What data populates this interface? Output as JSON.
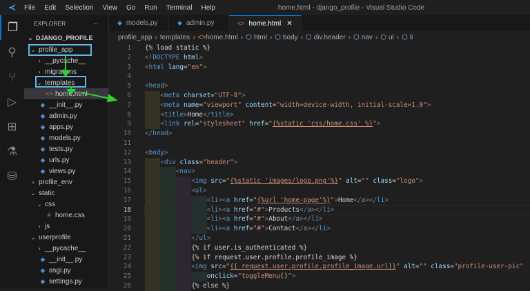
{
  "app": {
    "title": "home.html - django_profile - Visual Studio Code",
    "menu": [
      "File",
      "Edit",
      "Selection",
      "View",
      "Go",
      "Run",
      "Terminal",
      "Help"
    ]
  },
  "activity": [
    "explorer-icon",
    "search-icon",
    "source-control-icon",
    "run-debug-icon",
    "extensions-icon",
    "testing-icon",
    "database-icon"
  ],
  "sidebar": {
    "title": "EXPLORER",
    "more": "···",
    "project": "DJANGO_PROFILE",
    "items": [
      {
        "label": "profile_app",
        "level": 1,
        "kind": "open"
      },
      {
        "label": "__pycache__",
        "level": 2,
        "kind": "closed"
      },
      {
        "label": "migrations",
        "level": 2,
        "kind": "closed"
      },
      {
        "label": "templates",
        "level": 2,
        "kind": "open"
      },
      {
        "label": "home.html",
        "level": 3,
        "kind": "html",
        "selected": true
      },
      {
        "label": "__init__.py",
        "level": 2,
        "kind": "py"
      },
      {
        "label": "admin.py",
        "level": 2,
        "kind": "py"
      },
      {
        "label": "apps.py",
        "level": 2,
        "kind": "py"
      },
      {
        "label": "models.py",
        "level": 2,
        "kind": "py"
      },
      {
        "label": "tests.py",
        "level": 2,
        "kind": "py"
      },
      {
        "label": "urls.py",
        "level": 2,
        "kind": "py"
      },
      {
        "label": "views.py",
        "level": 2,
        "kind": "py"
      },
      {
        "label": "profile_env",
        "level": 1,
        "kind": "closed"
      },
      {
        "label": "static",
        "level": 1,
        "kind": "open"
      },
      {
        "label": "css",
        "level": 2,
        "kind": "open"
      },
      {
        "label": "home.css",
        "level": 3,
        "kind": "css"
      },
      {
        "label": "js",
        "level": 2,
        "kind": "closed"
      },
      {
        "label": "userprofile",
        "level": 1,
        "kind": "open"
      },
      {
        "label": "__pycache__",
        "level": 2,
        "kind": "closed"
      },
      {
        "label": "__init__.py",
        "level": 2,
        "kind": "py"
      },
      {
        "label": "asgi.py",
        "level": 2,
        "kind": "py"
      },
      {
        "label": "settings.py",
        "level": 2,
        "kind": "py"
      }
    ]
  },
  "tabs": [
    {
      "label": "models.py",
      "kind": "py"
    },
    {
      "label": "admin.py",
      "kind": "py"
    },
    {
      "label": "home.html",
      "kind": "html",
      "active": true,
      "close": "✕"
    }
  ],
  "breadcrumb": [
    "profile_app",
    "templates",
    "home.html",
    "html",
    "body",
    "div.header",
    "nav",
    "ul",
    "li"
  ],
  "editor": {
    "current_line": 18,
    "lines": [
      {
        "n": 1,
        "i": 0,
        "k": [
          [
            "d",
            "{% load static %}"
          ]
        ]
      },
      {
        "n": 2,
        "i": 0,
        "k": [
          [
            "b",
            "<!"
          ],
          [
            "t",
            "DOCTYPE"
          ],
          [
            "a",
            " html"
          ],
          [
            "b",
            ">"
          ]
        ]
      },
      {
        "n": 3,
        "i": 0,
        "k": [
          [
            "b",
            "<"
          ],
          [
            "t",
            "html"
          ],
          [
            "a",
            " lang"
          ],
          [
            "x",
            "="
          ],
          [
            "s",
            "\"en\""
          ],
          [
            "b",
            ">"
          ]
        ]
      },
      {
        "n": 4,
        "i": 0,
        "k": []
      },
      {
        "n": 5,
        "i": 0,
        "k": [
          [
            "b",
            "<"
          ],
          [
            "t",
            "head"
          ],
          [
            "b",
            ">"
          ]
        ]
      },
      {
        "n": 6,
        "i": 1,
        "k": [
          [
            "b",
            "<"
          ],
          [
            "t",
            "meta"
          ],
          [
            "a",
            " charset"
          ],
          [
            "x",
            "="
          ],
          [
            "s",
            "\"UTF-8\""
          ],
          [
            "b",
            ">"
          ]
        ]
      },
      {
        "n": 7,
        "i": 1,
        "k": [
          [
            "b",
            "<"
          ],
          [
            "t",
            "meta"
          ],
          [
            "a",
            " name"
          ],
          [
            "x",
            "="
          ],
          [
            "s",
            "\"viewport\""
          ],
          [
            "a",
            " content"
          ],
          [
            "x",
            "="
          ],
          [
            "s",
            "\"width=device-width, initial-scale=1.0\""
          ],
          [
            "b",
            ">"
          ]
        ]
      },
      {
        "n": 8,
        "i": 1,
        "k": [
          [
            "b",
            "<"
          ],
          [
            "t",
            "title"
          ],
          [
            "b",
            ">"
          ],
          [
            "x",
            "Home"
          ],
          [
            "b",
            "</"
          ],
          [
            "t",
            "title"
          ],
          [
            "b",
            ">"
          ]
        ]
      },
      {
        "n": 9,
        "i": 1,
        "k": [
          [
            "b",
            "<"
          ],
          [
            "t",
            "link"
          ],
          [
            "a",
            " rel"
          ],
          [
            "x",
            "="
          ],
          [
            "s",
            "\"stylesheet\""
          ],
          [
            "a",
            " href"
          ],
          [
            "x",
            "="
          ],
          [
            "s",
            "\""
          ],
          [
            "u",
            "{%static 'css/home.css' %}"
          ],
          [
            "s",
            "\""
          ],
          [
            "b",
            ">"
          ]
        ]
      },
      {
        "n": 10,
        "i": 0,
        "k": [
          [
            "b",
            "</"
          ],
          [
            "t",
            "head"
          ],
          [
            "b",
            ">"
          ]
        ]
      },
      {
        "n": 11,
        "i": 0,
        "k": []
      },
      {
        "n": 12,
        "i": 0,
        "k": [
          [
            "b",
            "<"
          ],
          [
            "t",
            "body"
          ],
          [
            "b",
            ">"
          ]
        ]
      },
      {
        "n": 13,
        "i": 1,
        "k": [
          [
            "b",
            "<"
          ],
          [
            "t",
            "div"
          ],
          [
            "a",
            " class"
          ],
          [
            "x",
            "="
          ],
          [
            "s",
            "\"header\""
          ],
          [
            "b",
            ">"
          ]
        ]
      },
      {
        "n": 14,
        "i": 2,
        "k": [
          [
            "b",
            "<"
          ],
          [
            "t",
            "nav"
          ],
          [
            "b",
            ">"
          ]
        ]
      },
      {
        "n": 15,
        "i": 3,
        "k": [
          [
            "b",
            "<"
          ],
          [
            "t",
            "img"
          ],
          [
            "a",
            " src"
          ],
          [
            "x",
            "="
          ],
          [
            "s",
            "\""
          ],
          [
            "u",
            "{%static 'images/logo.png'%}"
          ],
          [
            "s",
            "\""
          ],
          [
            "a",
            " alt"
          ],
          [
            "x",
            "="
          ],
          [
            "s",
            "\"\""
          ],
          [
            "a",
            " class"
          ],
          [
            "x",
            "="
          ],
          [
            "s",
            "\"logo\""
          ],
          [
            "b",
            ">"
          ]
        ]
      },
      {
        "n": 16,
        "i": 3,
        "k": [
          [
            "b",
            "<"
          ],
          [
            "t",
            "ul"
          ],
          [
            "b",
            ">"
          ]
        ]
      },
      {
        "n": 17,
        "i": 4,
        "k": [
          [
            "b",
            "<"
          ],
          [
            "t",
            "li"
          ],
          [
            "b",
            "><"
          ],
          [
            "t",
            "a"
          ],
          [
            "a",
            " href"
          ],
          [
            "x",
            "="
          ],
          [
            "s",
            "\""
          ],
          [
            "u",
            "{%url 'home-page'%}"
          ],
          [
            "s",
            "\""
          ],
          [
            "b",
            ">"
          ],
          [
            "x",
            "Home"
          ],
          [
            "b",
            "</"
          ],
          [
            "t",
            "a"
          ],
          [
            "b",
            "></"
          ],
          [
            "t",
            "li"
          ],
          [
            "b",
            ">"
          ]
        ]
      },
      {
        "n": 18,
        "i": 4,
        "k": [
          [
            "b",
            "<"
          ],
          [
            "t",
            "li"
          ],
          [
            "b",
            "><"
          ],
          [
            "t",
            "a"
          ],
          [
            "a",
            " href"
          ],
          [
            "x",
            "="
          ],
          [
            "s",
            "\"#\""
          ],
          [
            "b",
            ">"
          ],
          [
            "x",
            "Products"
          ],
          [
            "b",
            "</"
          ],
          [
            "t",
            "a"
          ],
          [
            "b",
            "></"
          ],
          [
            "t",
            "li"
          ],
          [
            "b",
            ">"
          ]
        ]
      },
      {
        "n": 19,
        "i": 4,
        "k": [
          [
            "b",
            "<"
          ],
          [
            "t",
            "li"
          ],
          [
            "b",
            "><"
          ],
          [
            "t",
            "a"
          ],
          [
            "a",
            " href"
          ],
          [
            "x",
            "="
          ],
          [
            "s",
            "\"#\""
          ],
          [
            "b",
            ">"
          ],
          [
            "x",
            "About"
          ],
          [
            "b",
            "</"
          ],
          [
            "t",
            "a"
          ],
          [
            "b",
            "></"
          ],
          [
            "t",
            "li"
          ],
          [
            "b",
            ">"
          ]
        ]
      },
      {
        "n": 20,
        "i": 4,
        "k": [
          [
            "b",
            "<"
          ],
          [
            "t",
            "li"
          ],
          [
            "b",
            "><"
          ],
          [
            "t",
            "a"
          ],
          [
            "a",
            " href"
          ],
          [
            "x",
            "="
          ],
          [
            "s",
            "\"#\""
          ],
          [
            "b",
            ">"
          ],
          [
            "x",
            "Contact"
          ],
          [
            "b",
            "</"
          ],
          [
            "t",
            "a"
          ],
          [
            "b",
            "></"
          ],
          [
            "t",
            "li"
          ],
          [
            "b",
            ">"
          ]
        ]
      },
      {
        "n": 21,
        "i": 3,
        "k": [
          [
            "b",
            "</"
          ],
          [
            "t",
            "ul"
          ],
          [
            "b",
            ">"
          ]
        ]
      },
      {
        "n": 22,
        "i": 3,
        "k": [
          [
            "d",
            "{% if user.is_authenticated %}"
          ]
        ]
      },
      {
        "n": 23,
        "i": 3,
        "k": [
          [
            "d",
            "{% if request.user.profile.profile_image %}"
          ]
        ]
      },
      {
        "n": 24,
        "i": 3,
        "k": [
          [
            "b",
            "<"
          ],
          [
            "t",
            "img"
          ],
          [
            "a",
            " src"
          ],
          [
            "x",
            "="
          ],
          [
            "s",
            "\""
          ],
          [
            "u",
            "{{ request.user.profile.profile_image.url}}"
          ],
          [
            "s",
            "\""
          ],
          [
            "a",
            " alt"
          ],
          [
            "x",
            "="
          ],
          [
            "s",
            "\"\""
          ],
          [
            "a",
            " class"
          ],
          [
            "x",
            "="
          ],
          [
            "s",
            "\"profile-user-pic\""
          ]
        ]
      },
      {
        "n": 25,
        "i": 4,
        "k": [
          [
            "a",
            "onclick"
          ],
          [
            "x",
            "="
          ],
          [
            "s",
            "\"toggleMenu"
          ],
          [
            "y",
            "()"
          ],
          [
            "s",
            "\""
          ],
          [
            "b",
            ">"
          ]
        ]
      },
      {
        "n": 26,
        "i": 3,
        "k": [
          [
            "d",
            "{% else %}"
          ]
        ]
      }
    ]
  }
}
